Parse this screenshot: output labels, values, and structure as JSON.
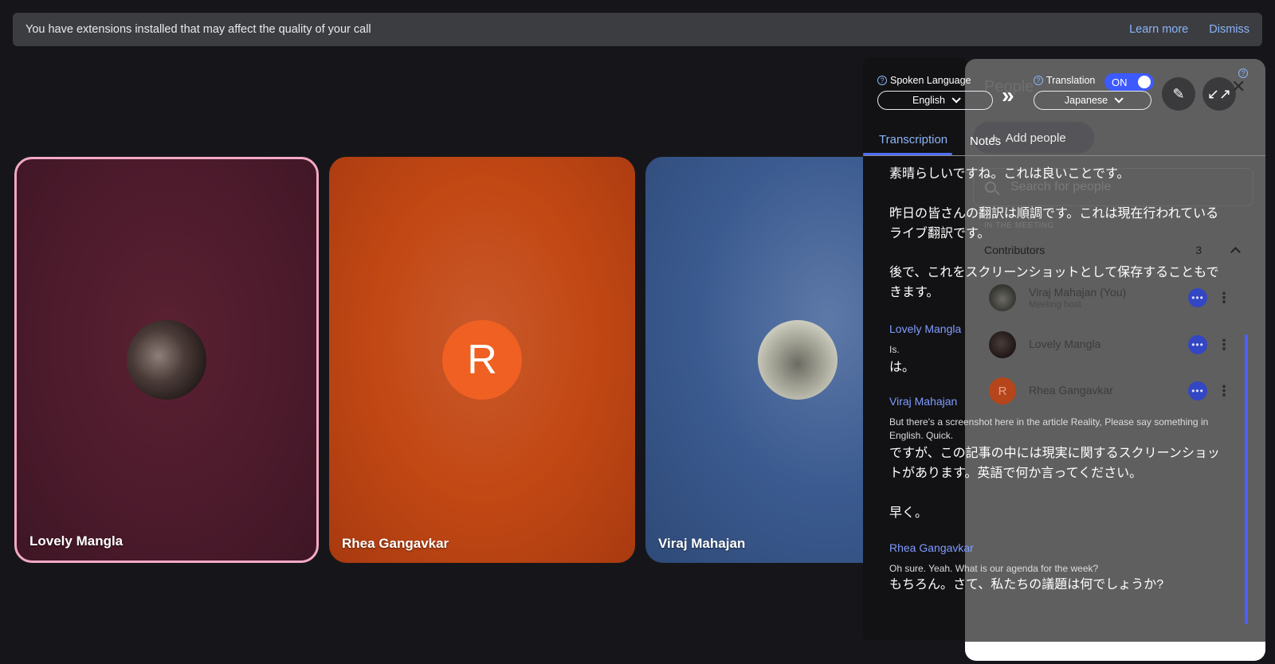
{
  "banner": {
    "message": "You have extensions installed that may affect the quality of your call",
    "learn_more": "Learn more",
    "dismiss": "Dismiss"
  },
  "tiles": [
    {
      "name": "Lovely Mangla"
    },
    {
      "name": "Rhea Gangavkar",
      "avatar_letter": "R"
    },
    {
      "name": "Viraj Mahajan"
    }
  ],
  "translator": {
    "spoken_language_label": "Spoken Language",
    "spoken_language_value": "English",
    "translation_label": "Translation",
    "translation_toggle": "ON",
    "translation_value": "Japanese",
    "tabs": [
      "Transcription",
      "Notes"
    ]
  },
  "people_panel": {
    "title": "People",
    "add_people": "Add people",
    "search_placeholder": "Search for people",
    "section_label": "IN THE MEETING",
    "contributors_label": "Contributors",
    "contributors_count": "3",
    "people": [
      {
        "name": "Viraj Mahajan (You)",
        "sub": "Meeting host"
      },
      {
        "name": "Lovely Mangla",
        "sub": ""
      },
      {
        "name": "Rhea Gangavkar",
        "sub": "",
        "avatar_letter": "R"
      }
    ]
  },
  "transcript": {
    "line1": "素晴らしいですね。これは良いことです。",
    "line2": "昨日の皆さんの翻訳は順調です。これは現在行われているライブ翻訳です。",
    "line3": "後で、これをスクリーンショットとして保存することもできます。",
    "entry1": {
      "speaker": "Lovely Mangla",
      "english": "Is.",
      "japanese": "は。"
    },
    "entry2": {
      "speaker": "Viraj Mahajan",
      "english": "But there's a screenshot here in the article Reality, Please say something in English. Quick.",
      "japanese": "ですが、この記事の中には現実に関するスクリーンショットがあります。英語で何か言ってください。",
      "japanese2": "早く。"
    },
    "entry3": {
      "speaker": "Rhea Gangavkar",
      "english": "Oh sure. Yeah. What is our agenda for the week?",
      "japanese": "もちろん。さて、私たちの議題は何でしょうか?"
    }
  }
}
